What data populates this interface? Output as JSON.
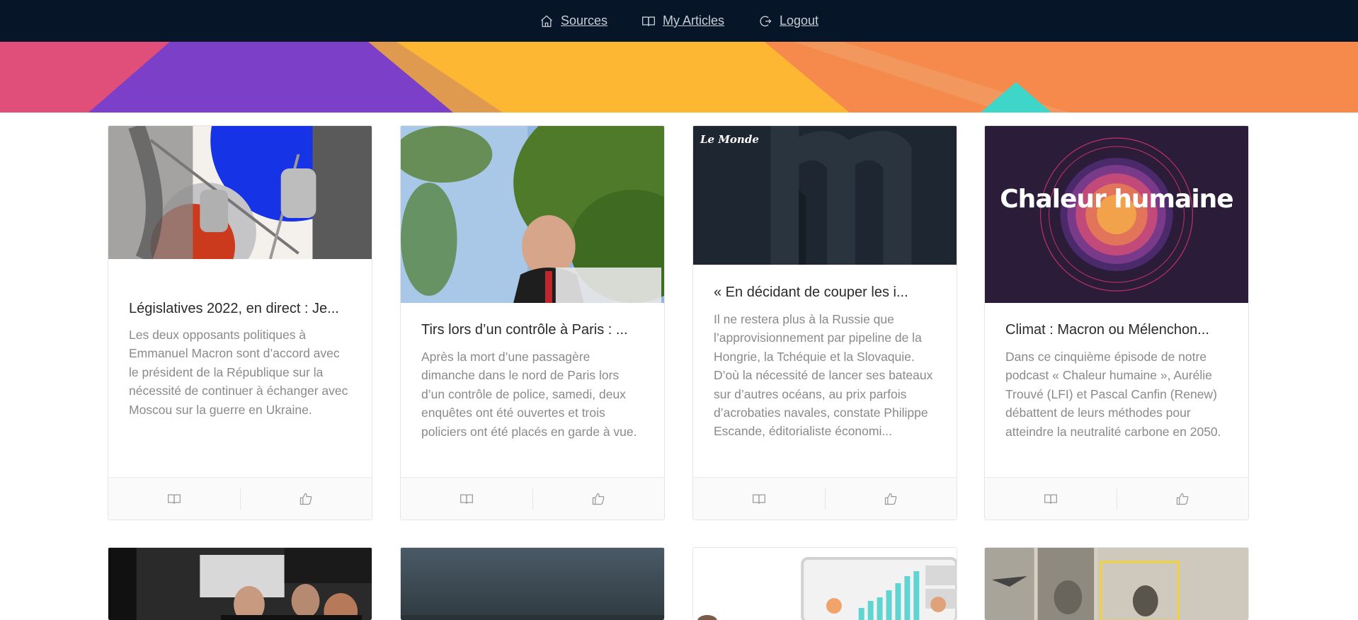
{
  "nav": {
    "items": [
      {
        "label": "Sources",
        "icon": "home-icon"
      },
      {
        "label": "My Articles",
        "icon": "book-icon"
      },
      {
        "label": "Logout",
        "icon": "logout-icon"
      }
    ]
  },
  "banner": {
    "colors": [
      "#e04e7a",
      "#7b3fc8",
      "#fdb733",
      "#f58a4c",
      "#3dd6c8"
    ]
  },
  "articles": [
    {
      "title": "Législatives 2022, en direct : Je...",
      "description": "Les deux opposants politiques à Emmanuel Macron sont d’accord avec le président de la République sur la nécessité de continuer à échanger avec Moscou sur la guerre en Ukraine.",
      "image": "microphones-illustration"
    },
    {
      "title": "Tirs lors d’un contrôle à Paris : ...",
      "description": "Après la mort d’une passagère dimanche dans le nord de Paris lors d’un contrôle de police, samedi, deux enquêtes ont été ouvertes et trois policiers ont été placés en garde à vue.",
      "image": "politician-speaking-photo"
    },
    {
      "title": "« En décidant de couper les i...",
      "description": "Il ne restera plus à la Russie que l’approvisionnement par pipeline de la Hongrie, la Tchéquie et la Slovaquie. D’où la nécessité de lancer ses bateaux sur d’autres océans, au prix parfois d’acrobaties navales, constate Philippe Escande, éditorialiste économi...",
      "image": "le-monde-placeholder",
      "logo": "Le Monde"
    },
    {
      "title": "Climat : Macron ou Mélenchon...",
      "description": "Dans ce cinquième épisode de notre podcast « Chaleur humaine », Aurélie Trouvé (LFI) et Pascal Canfin (Renew) débattent de leurs méthodes pour atteindre la neutralité carbone en 2050.",
      "image": "podcast-cover",
      "cover_text": "Chaleur humaine"
    }
  ],
  "card_actions": {
    "read_icon": "book-icon",
    "like_icon": "thumbs-up-icon"
  }
}
